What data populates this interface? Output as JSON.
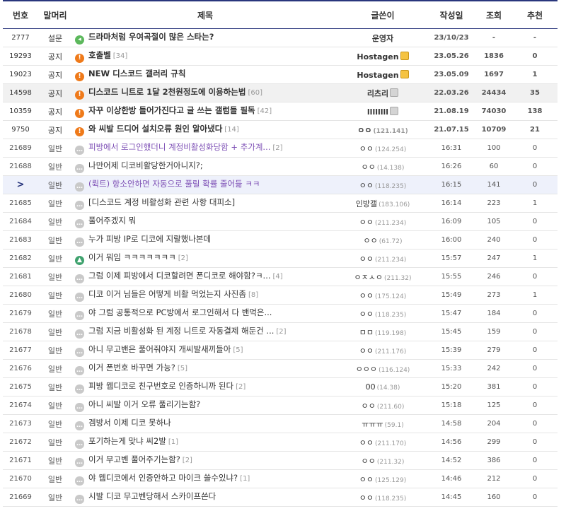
{
  "headers": {
    "num": "번호",
    "head": "말머리",
    "title": "제목",
    "writer": "글쓴이",
    "date": "작성일",
    "views": "조회",
    "recommend": "추천"
  },
  "rows": [
    {
      "num": "2777",
      "head": "설문",
      "icon": "survey-icon",
      "title": "드라마처럼 우여곡절이 많은 스타는?",
      "reply": "",
      "writer": "운영자",
      "ip": "",
      "badge": "",
      "date": "23/10/23",
      "views": "-",
      "rec": "-",
      "type": "notice"
    },
    {
      "num": "19293",
      "head": "공지",
      "icon": "notice-icon",
      "title": "호출벨",
      "reply": "[34]",
      "writer": "Hostagen",
      "ip": "",
      "badge": "gold",
      "date": "23.05.26",
      "views": "1836",
      "rec": "0",
      "type": "notice"
    },
    {
      "num": "19023",
      "head": "공지",
      "icon": "notice-icon",
      "title": "NEW 디스코드 갤러리 규칙",
      "reply": "",
      "writer": "Hostagen",
      "ip": "",
      "badge": "gold",
      "date": "23.05.09",
      "views": "1697",
      "rec": "1",
      "type": "notice"
    },
    {
      "num": "14598",
      "head": "공지",
      "icon": "notice-icon",
      "title": "디스코드 니트로 1달 2천원정도에 이용하는법",
      "reply": "[60]",
      "writer": "리츠리",
      "ip": "",
      "badge": "grey",
      "date": "22.03.26",
      "views": "24434",
      "rec": "35",
      "type": "notice-grey"
    },
    {
      "num": "10359",
      "head": "공지",
      "icon": "notice-icon",
      "title": "자꾸 이상한방 들어가진다고 글 쓰는 갤럼들 필독",
      "reply": "[42]",
      "writer": "llllllll",
      "ip": "",
      "badge": "grey",
      "date": "21.08.19",
      "views": "74030",
      "rec": "138",
      "type": "notice"
    },
    {
      "num": "9750",
      "head": "공지",
      "icon": "notice-icon",
      "title": "와 씨발 드디어 설치오류 원인 알아냈다",
      "reply": "[14]",
      "writer": "ㅇㅇ",
      "ip": "(121.141)",
      "badge": "",
      "date": "21.07.15",
      "views": "10709",
      "rec": "21",
      "type": "notice"
    },
    {
      "num": "21689",
      "head": "일반",
      "icon": "chat-icon",
      "title": "피방에서 로그인했더니 계정비활성화당함 + 추가계...",
      "reply": "[2]",
      "writer": "ㅇㅇ",
      "ip": "(124.254)",
      "badge": "",
      "date": "16:31",
      "views": "100",
      "rec": "0",
      "type": "purple"
    },
    {
      "num": "21688",
      "head": "일반",
      "icon": "chat-icon",
      "title": "나만어제 디코비활당한거아니지?;",
      "reply": "",
      "writer": "ㅇㅇ",
      "ip": "(14.138)",
      "badge": "",
      "date": "16:26",
      "views": "60",
      "rec": "0",
      "type": ""
    },
    {
      "num": ">",
      "head": "일반",
      "icon": "chat-icon",
      "title": "(뤽트) 항소안하면 자동으로 풀릴 확률 줄어듦 ㅋㅋ",
      "reply": "",
      "writer": "ㅇㅇ",
      "ip": "(118.235)",
      "badge": "",
      "date": "16:15",
      "views": "141",
      "rec": "0",
      "type": "current"
    },
    {
      "num": "21685",
      "head": "일반",
      "icon": "chat-icon",
      "title": "[디스코드 계정 비활성화 관련 사항 대피소]",
      "reply": "",
      "writer": "인방갤",
      "ip": "(183.106)",
      "badge": "",
      "date": "16:14",
      "views": "223",
      "rec": "1",
      "type": ""
    },
    {
      "num": "21684",
      "head": "일반",
      "icon": "chat-icon",
      "title": "풀어주겠지 뭐",
      "reply": "",
      "writer": "ㅇㅇ",
      "ip": "(211.234)",
      "badge": "",
      "date": "16:09",
      "views": "105",
      "rec": "0",
      "type": ""
    },
    {
      "num": "21683",
      "head": "일반",
      "icon": "chat-icon",
      "title": "누가 피방 IP로 디코에 지랄했나본데",
      "reply": "",
      "writer": "ㅇㅇ",
      "ip": "(61.72)",
      "badge": "",
      "date": "16:00",
      "views": "240",
      "rec": "0",
      "type": ""
    },
    {
      "num": "21682",
      "head": "일반",
      "icon": "image-icon",
      "title": "이거 뭐임 ㅋㅋㅋㅋㅋㅋㅋ",
      "reply": "[2]",
      "writer": "ㅇㅇ",
      "ip": "(211.234)",
      "badge": "",
      "date": "15:57",
      "views": "247",
      "rec": "1",
      "type": ""
    },
    {
      "num": "21681",
      "head": "일반",
      "icon": "chat-icon",
      "title": "그럼 이제 피방에서 디코할려면 폰디코로 해야함?ㅋ...",
      "reply": "[4]",
      "writer": "ㅇㅈㅅㅇ",
      "ip": "(211.32)",
      "badge": "",
      "date": "15:55",
      "views": "246",
      "rec": "0",
      "type": ""
    },
    {
      "num": "21680",
      "head": "일반",
      "icon": "chat-icon",
      "title": "디코 이거 님들은 어떻게 비활 먹었는지 사진좀",
      "reply": "[8]",
      "writer": "ㅇㅇ",
      "ip": "(175.124)",
      "badge": "",
      "date": "15:49",
      "views": "273",
      "rec": "1",
      "type": ""
    },
    {
      "num": "21679",
      "head": "일반",
      "icon": "chat-icon",
      "title": "야 그럼 공통적으로 PC방에서 로그인해서 다 밴먹은...",
      "reply": "",
      "writer": "ㅇㅇ",
      "ip": "(118.235)",
      "badge": "",
      "date": "15:47",
      "views": "184",
      "rec": "0",
      "type": ""
    },
    {
      "num": "21678",
      "head": "일반",
      "icon": "chat-icon",
      "title": "그럼 지금 비활성화 된 계정 니트로 자동결제 해둔건 ...",
      "reply": "[2]",
      "writer": "ㅁㅁ",
      "ip": "(119.198)",
      "badge": "",
      "date": "15:45",
      "views": "159",
      "rec": "0",
      "type": ""
    },
    {
      "num": "21677",
      "head": "일반",
      "icon": "chat-icon",
      "title": "아니 무고밴은 풀어줘야지 개씨발새끼들아",
      "reply": "[5]",
      "writer": "ㅇㅇ",
      "ip": "(211.176)",
      "badge": "",
      "date": "15:39",
      "views": "279",
      "rec": "0",
      "type": ""
    },
    {
      "num": "21676",
      "head": "일반",
      "icon": "chat-icon",
      "title": "이거 폰번호 바꾸면 가능?",
      "reply": "[5]",
      "writer": "ㅇㅇㅇ",
      "ip": "(116.124)",
      "badge": "",
      "date": "15:33",
      "views": "242",
      "rec": "0",
      "type": ""
    },
    {
      "num": "21675",
      "head": "일반",
      "icon": "chat-icon",
      "title": "피방 웹디코로 친구번호로 인증하니까 된다",
      "reply": "[2]",
      "writer": "00",
      "ip": "(14.38)",
      "badge": "",
      "date": "15:20",
      "views": "381",
      "rec": "0",
      "type": ""
    },
    {
      "num": "21674",
      "head": "일반",
      "icon": "chat-icon",
      "title": "아니 씨발 이거 오류 풀리기는함?",
      "reply": "",
      "writer": "ㅇㅇ",
      "ip": "(211.60)",
      "badge": "",
      "date": "15:18",
      "views": "125",
      "rec": "0",
      "type": ""
    },
    {
      "num": "21673",
      "head": "일반",
      "icon": "chat-icon",
      "title": "겜방서 이제 디코 못하나",
      "reply": "",
      "writer": "ㅠㅠㅠ",
      "ip": "(59.1)",
      "badge": "",
      "date": "14:58",
      "views": "204",
      "rec": "0",
      "type": ""
    },
    {
      "num": "21672",
      "head": "일반",
      "icon": "chat-icon",
      "title": "포기하는게 맞냐 씨2발",
      "reply": "[1]",
      "writer": "ㅇㅇ",
      "ip": "(211.170)",
      "badge": "",
      "date": "14:56",
      "views": "299",
      "rec": "0",
      "type": ""
    },
    {
      "num": "21671",
      "head": "일반",
      "icon": "chat-icon",
      "title": "이거 무고벤 풀어주기는함?",
      "reply": "[2]",
      "writer": "ㅇㅇ",
      "ip": "(211.32)",
      "badge": "",
      "date": "14:52",
      "views": "386",
      "rec": "0",
      "type": ""
    },
    {
      "num": "21670",
      "head": "일반",
      "icon": "chat-icon",
      "title": "야 웹디코에서 인증안하고 마이크 쓸수있냐?",
      "reply": "[1]",
      "writer": "ㅇㅇ",
      "ip": "(125.129)",
      "badge": "",
      "date": "14:46",
      "views": "212",
      "rec": "0",
      "type": ""
    },
    {
      "num": "21669",
      "head": "일반",
      "icon": "chat-icon",
      "title": "시발 디코 무고벤당해서 스카이프쓴다",
      "reply": "",
      "writer": "ㅇㅇ",
      "ip": "(118.235)",
      "badge": "",
      "date": "14:45",
      "views": "160",
      "rec": "0",
      "type": ""
    }
  ],
  "colors": {
    "header_line": "#29367c",
    "notice_icon": "#ef7a1a",
    "current_row_bg": "#eef1fb",
    "grey_row_bg": "#f1f1f1",
    "visited_title": "#7d4fb5"
  }
}
